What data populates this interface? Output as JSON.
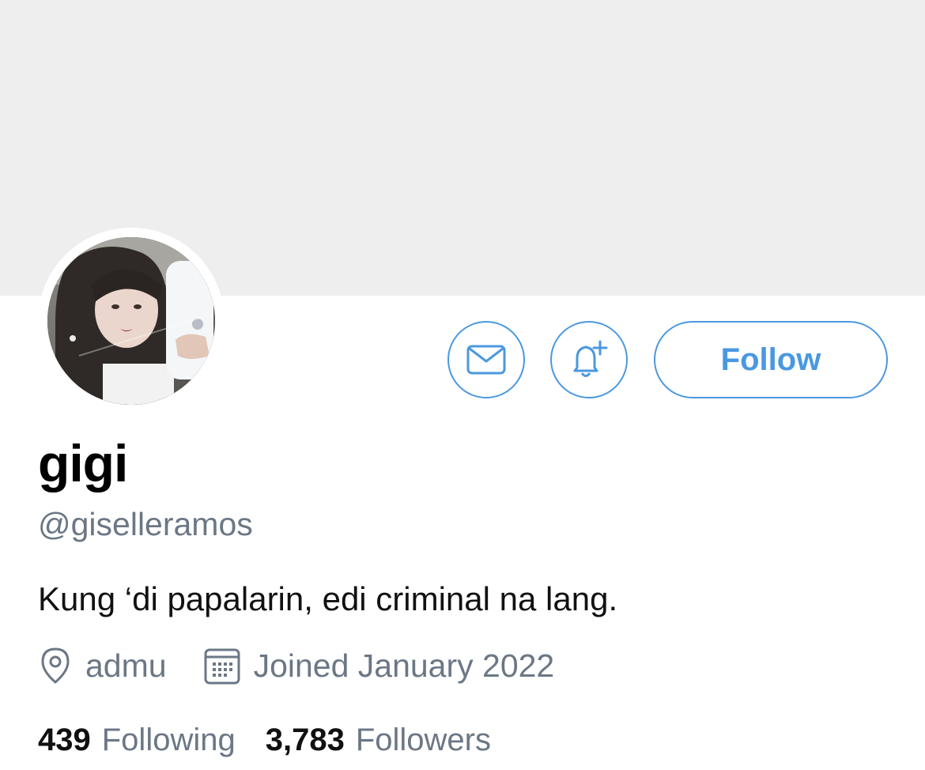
{
  "profile": {
    "display_name": "gigi",
    "handle": "@giselleramos",
    "bio": "Kung ‘di papalarin, edi criminal na lang.",
    "location": "admu",
    "joined": "Joined January 2022"
  },
  "actions": {
    "follow_label": "Follow",
    "message_icon": "envelope-icon",
    "notify_icon": "bell-plus-icon"
  },
  "stats": {
    "following_count": "439",
    "following_label": "Following",
    "followers_count": "3,783",
    "followers_label": "Followers"
  },
  "icons": {
    "location": "location-pin-icon",
    "joined": "calendar-icon"
  },
  "colors": {
    "accent": "#4a98e0",
    "banner": "#eeeeee",
    "secondary_text": "#6b7785",
    "primary_text": "#111111"
  }
}
